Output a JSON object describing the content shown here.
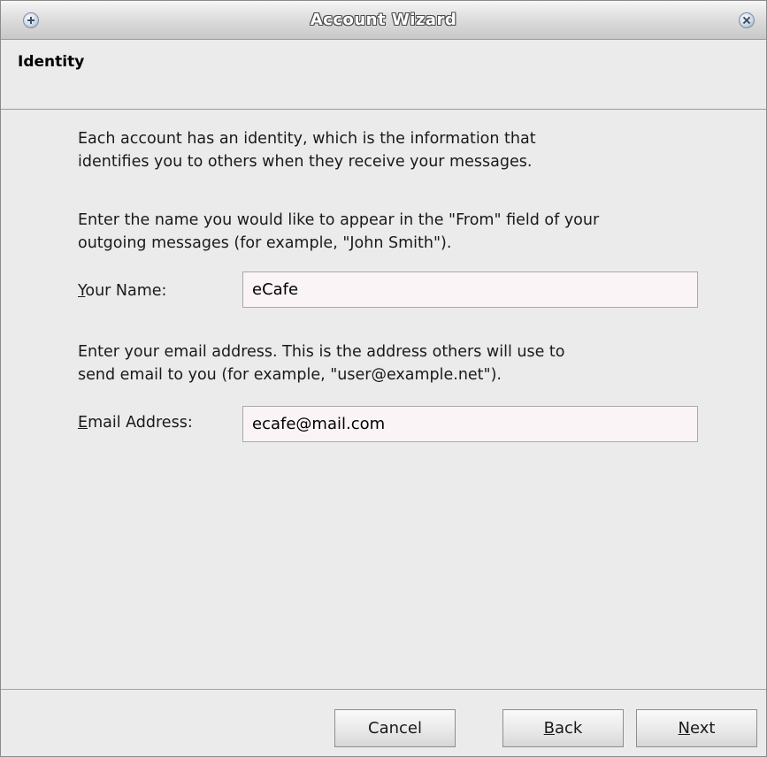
{
  "window": {
    "title": "Account Wizard"
  },
  "header": {
    "title": "Identity"
  },
  "content": {
    "intro_line1": "Each account has an identity, which is the information that",
    "intro_line2": "identifies you to others when they receive your messages.",
    "name_help_line1": "Enter the name you would like to appear in the \"From\" field of your",
    "name_help_line2": "outgoing messages (for example, \"John Smith\").",
    "name_label_mnemonic": "Y",
    "name_label_rest": "our Name:",
    "name_value": "eCafe",
    "email_help_line1": "Enter your email address. This is the address others will use to",
    "email_help_line2": "send email to you (for example, \"user@example.net\").",
    "email_label_mnemonic": "E",
    "email_label_rest": "mail Address:",
    "email_value": "ecafe@mail.com"
  },
  "footer": {
    "cancel_label": "Cancel",
    "back_mnemonic": "B",
    "back_rest": "ack",
    "next_mnemonic": "N",
    "next_rest": "ext"
  },
  "icons": {
    "window_menu": "plus-circle-icon",
    "window_close": "close-circle-icon"
  },
  "colors": {
    "input_background": "#fbf4f6",
    "window_background": "#ebebeb"
  }
}
